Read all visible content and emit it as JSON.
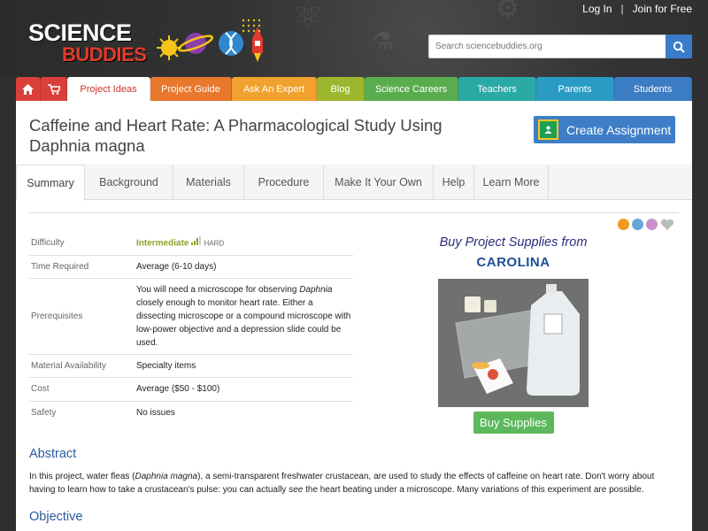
{
  "header": {
    "logo_word1": "SCIENCE",
    "logo_word2": "BUDDIES",
    "login": "Log In",
    "separator": "|",
    "join": "Join for Free",
    "search_placeholder": "Search sciencebuddies.org"
  },
  "nav": {
    "items": [
      {
        "label": "",
        "icon": "home-icon",
        "color": "#d9403a"
      },
      {
        "label": "",
        "icon": "cart-icon",
        "color": "#d9403a"
      },
      {
        "label": "Project Ideas",
        "color": "#d9403a"
      },
      {
        "label": "Project Guide",
        "color": "#e8782c"
      },
      {
        "label": "Ask An Expert",
        "color": "#f1a22e"
      },
      {
        "label": "Blog",
        "color": "#9cb72e"
      },
      {
        "label": "Science Careers",
        "color": "#59ad4e"
      },
      {
        "label": "Teachers",
        "color": "#2aa9a5"
      },
      {
        "label": "Parents",
        "color": "#2a9bc4"
      },
      {
        "label": "Students",
        "color": "#3b7cc2"
      }
    ],
    "active_index": 2
  },
  "page": {
    "title": "Caffeine and Heart Rate: A Pharmacological Study Using Daphnia magna",
    "create_assignment": "Create Assignment"
  },
  "tabs": [
    "Summary",
    "Background",
    "Materials",
    "Procedure",
    "Make It Your Own",
    "Help",
    "Learn More"
  ],
  "active_tab": 0,
  "summary": {
    "difficulty_label": "Difficulty",
    "difficulty_value": "Intermediate",
    "difficulty_hard": "HARD",
    "difficulty_level": 3,
    "time_label": "Time Required",
    "time_value": "Average (6-10 days)",
    "prereq_label": "Prerequisites",
    "prereq_part1": "You will need a microscope for observing ",
    "prereq_italic": "Daphnia",
    "prereq_part2": " closely enough to monitor heart rate. Either a dissecting microscope or a compound microscope with low-power objective and a depression slide could be used.",
    "material_label": "Material Availability",
    "material_value": "Specialty items",
    "cost_label": "Cost",
    "cost_value": "Average ($50 - $100)",
    "safety_label": "Safety",
    "safety_value": "No issues"
  },
  "supplies": {
    "heading": "Buy Project Supplies from",
    "brand": "CAROLINA",
    "button": "Buy Supplies"
  },
  "abstract": {
    "heading": "Abstract",
    "p1": "In this project, water fleas (",
    "p1_italic": "Daphnia magna",
    "p2": "), a semi-transparent freshwater crustacean, are used to study the effects of caffeine on heart rate. Don't worry about having to learn how to take a crustacean's pulse: you can actually ",
    "p2_italic": "see",
    "p3": " the heart beating under a microscope. Many variations of this experiment are possible."
  },
  "objective": {
    "heading": "Objective"
  },
  "share_icons": [
    "rss-icon",
    "print-icon",
    "email-icon",
    "heart-icon"
  ]
}
